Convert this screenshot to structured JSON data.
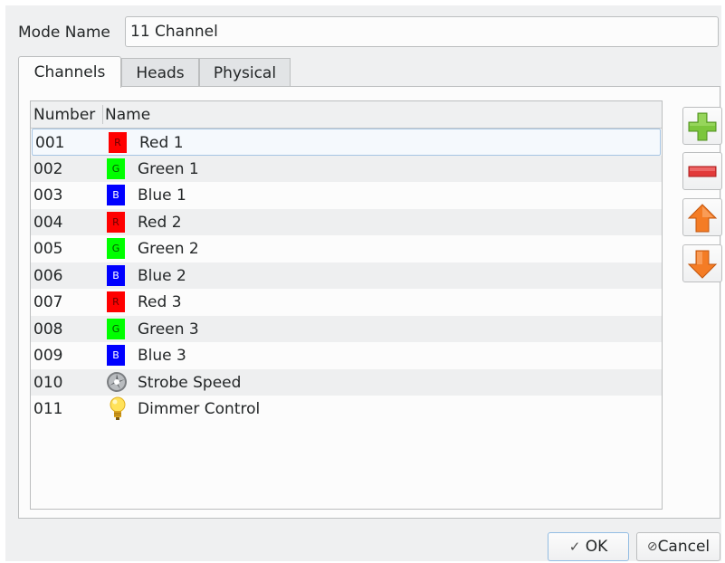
{
  "mode": {
    "label": "Mode Name",
    "value": "11 Channel"
  },
  "tabs": [
    {
      "label": "Channels",
      "active": true
    },
    {
      "label": "Heads",
      "active": false
    },
    {
      "label": "Physical",
      "active": false
    }
  ],
  "table": {
    "columns": [
      "Number",
      "Name"
    ],
    "rows": [
      {
        "number": "001",
        "name": "Red 1",
        "icon": "red-channel-icon",
        "chip": "R",
        "color": "#ff0000",
        "text_color": "#6b0000"
      },
      {
        "number": "002",
        "name": "Green 1",
        "icon": "green-channel-icon",
        "chip": "G",
        "color": "#00ff00",
        "text_color": "#005500"
      },
      {
        "number": "003",
        "name": "Blue 1",
        "icon": "blue-channel-icon",
        "chip": "B",
        "color": "#0000ff",
        "text_color": "#ffffff"
      },
      {
        "number": "004",
        "name": "Red 2",
        "icon": "red-channel-icon",
        "chip": "R",
        "color": "#ff0000",
        "text_color": "#6b0000"
      },
      {
        "number": "005",
        "name": "Green 2",
        "icon": "green-channel-icon",
        "chip": "G",
        "color": "#00ff00",
        "text_color": "#005500"
      },
      {
        "number": "006",
        "name": "Blue 2",
        "icon": "blue-channel-icon",
        "chip": "B",
        "color": "#0000ff",
        "text_color": "#ffffff"
      },
      {
        "number": "007",
        "name": "Red 3",
        "icon": "red-channel-icon",
        "chip": "R",
        "color": "#ff0000",
        "text_color": "#6b0000"
      },
      {
        "number": "008",
        "name": "Green 3",
        "icon": "green-channel-icon",
        "chip": "G",
        "color": "#00ff00",
        "text_color": "#005500"
      },
      {
        "number": "009",
        "name": "Blue 3",
        "icon": "blue-channel-icon",
        "chip": "B",
        "color": "#0000ff",
        "text_color": "#ffffff"
      },
      {
        "number": "010",
        "name": "Strobe Speed",
        "icon": "strobe-icon"
      },
      {
        "number": "011",
        "name": "Dimmer Control",
        "icon": "light-bulb-icon"
      }
    ]
  },
  "side_buttons": [
    {
      "name": "add-channel-button",
      "icon": "plus-icon",
      "color": "#7cc63c"
    },
    {
      "name": "remove-channel-button",
      "icon": "minus-icon",
      "color": "#e23a3a"
    },
    {
      "name": "move-up-button",
      "icon": "arrow-up-icon",
      "color": "#f47c25"
    },
    {
      "name": "move-down-button",
      "icon": "arrow-down-icon",
      "color": "#f47c25"
    }
  ],
  "footer": {
    "ok_label": "OK",
    "ok_icon": "checkmark-icon",
    "cancel_label": "Cancel",
    "cancel_icon": "cancel-circle-icon"
  },
  "colors": {
    "window_bg": "#eff0f1",
    "view_bg": "#fcfcfc",
    "alt_row": "#eeeff0",
    "selection_border": "#a6c5e3"
  }
}
